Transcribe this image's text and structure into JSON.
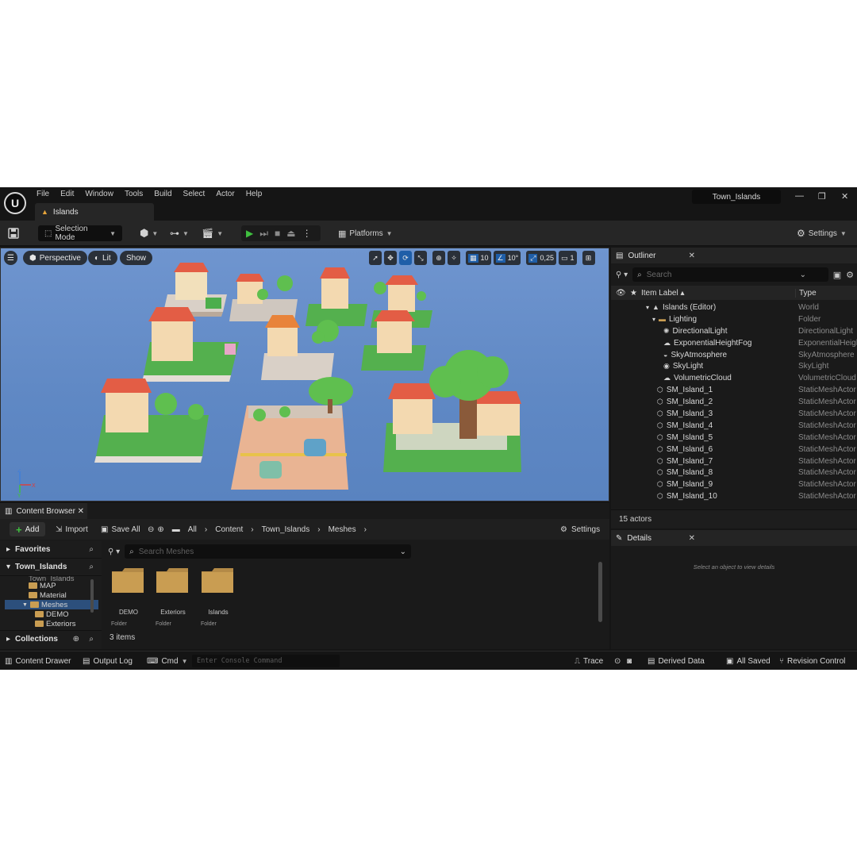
{
  "menu": [
    "File",
    "Edit",
    "Window",
    "Tools",
    "Build",
    "Select",
    "Actor",
    "Help"
  ],
  "document_tab": "Islands",
  "project_name": "Town_Islands",
  "toolbar": {
    "selection_mode": "Selection Mode",
    "platforms": "Platforms",
    "settings": "Settings"
  },
  "viewport": {
    "perspective": "Perspective",
    "lit": "Lit",
    "show": "Show",
    "grid_snap": "10",
    "rotation_snap": "10°",
    "scale_snap": "0,25",
    "camera_speed": "1"
  },
  "outliner": {
    "title": "Outliner",
    "search_placeholder": "Search",
    "col_label": "Item Label",
    "col_type": "Type",
    "rows": [
      {
        "label": "Islands (Editor)",
        "type": "World",
        "icon": "world-icon"
      },
      {
        "label": "Lighting",
        "type": "Folder",
        "icon": "folder-icon"
      },
      {
        "label": "DirectionalLight",
        "type": "DirectionalLight",
        "icon": "sun-icon"
      },
      {
        "label": "ExponentialHeightFog",
        "type": "ExponentialHeigl",
        "icon": "fog-icon"
      },
      {
        "label": "SkyAtmosphere",
        "type": "SkyAtmosphere",
        "icon": "sky-icon"
      },
      {
        "label": "SkyLight",
        "type": "SkyLight",
        "icon": "skylight-icon"
      },
      {
        "label": "VolumetricCloud",
        "type": "VolumetricCloud",
        "icon": "cloud-icon"
      },
      {
        "label": "SM_Island_1",
        "type": "StaticMeshActor",
        "icon": "mesh-icon"
      },
      {
        "label": "SM_Island_2",
        "type": "StaticMeshActor",
        "icon": "mesh-icon"
      },
      {
        "label": "SM_Island_3",
        "type": "StaticMeshActor",
        "icon": "mesh-icon"
      },
      {
        "label": "SM_Island_4",
        "type": "StaticMeshActor",
        "icon": "mesh-icon"
      },
      {
        "label": "SM_Island_5",
        "type": "StaticMeshActor",
        "icon": "mesh-icon"
      },
      {
        "label": "SM_Island_6",
        "type": "StaticMeshActor",
        "icon": "mesh-icon"
      },
      {
        "label": "SM_Island_7",
        "type": "StaticMeshActor",
        "icon": "mesh-icon"
      },
      {
        "label": "SM_Island_8",
        "type": "StaticMeshActor",
        "icon": "mesh-icon"
      },
      {
        "label": "SM_Island_9",
        "type": "StaticMeshActor",
        "icon": "mesh-icon"
      },
      {
        "label": "SM_Island_10",
        "type": "StaticMeshActor",
        "icon": "mesh-icon"
      }
    ],
    "footer": "15 actors"
  },
  "details": {
    "title": "Details",
    "hint": "Select an object to view details"
  },
  "content_browser": {
    "title": "Content Browser",
    "add": "Add",
    "import": "Import",
    "save_all": "Save All",
    "breadcrumb": [
      "All",
      "Content",
      "Town_Islands",
      "Meshes"
    ],
    "settings": "Settings",
    "favorites": "Favorites",
    "project_root": "Town_Islands",
    "tree": [
      "Town_Islands",
      "MAP",
      "Material",
      "Meshes",
      "DEMO",
      "Exteriors"
    ],
    "search_placeholder": "Search Meshes",
    "items": [
      {
        "name": "DEMO",
        "kind": "Folder"
      },
      {
        "name": "Exteriors",
        "kind": "Folder"
      },
      {
        "name": "Islands",
        "kind": "Folder"
      }
    ],
    "count": "3 items",
    "collections": "Collections"
  },
  "statusbar": {
    "content_drawer": "Content Drawer",
    "output_log": "Output Log",
    "cmd": "Cmd",
    "console_placeholder": "Enter Console Command",
    "trace": "Trace",
    "derived_data": "Derived Data",
    "all_saved": "All Saved",
    "revision_control": "Revision Control"
  },
  "colors": {
    "accent_blue": "#1f5ea8",
    "play_green": "#3fbf3f",
    "folder": "#c99d52",
    "viewport_sky": "#6f95cf"
  }
}
